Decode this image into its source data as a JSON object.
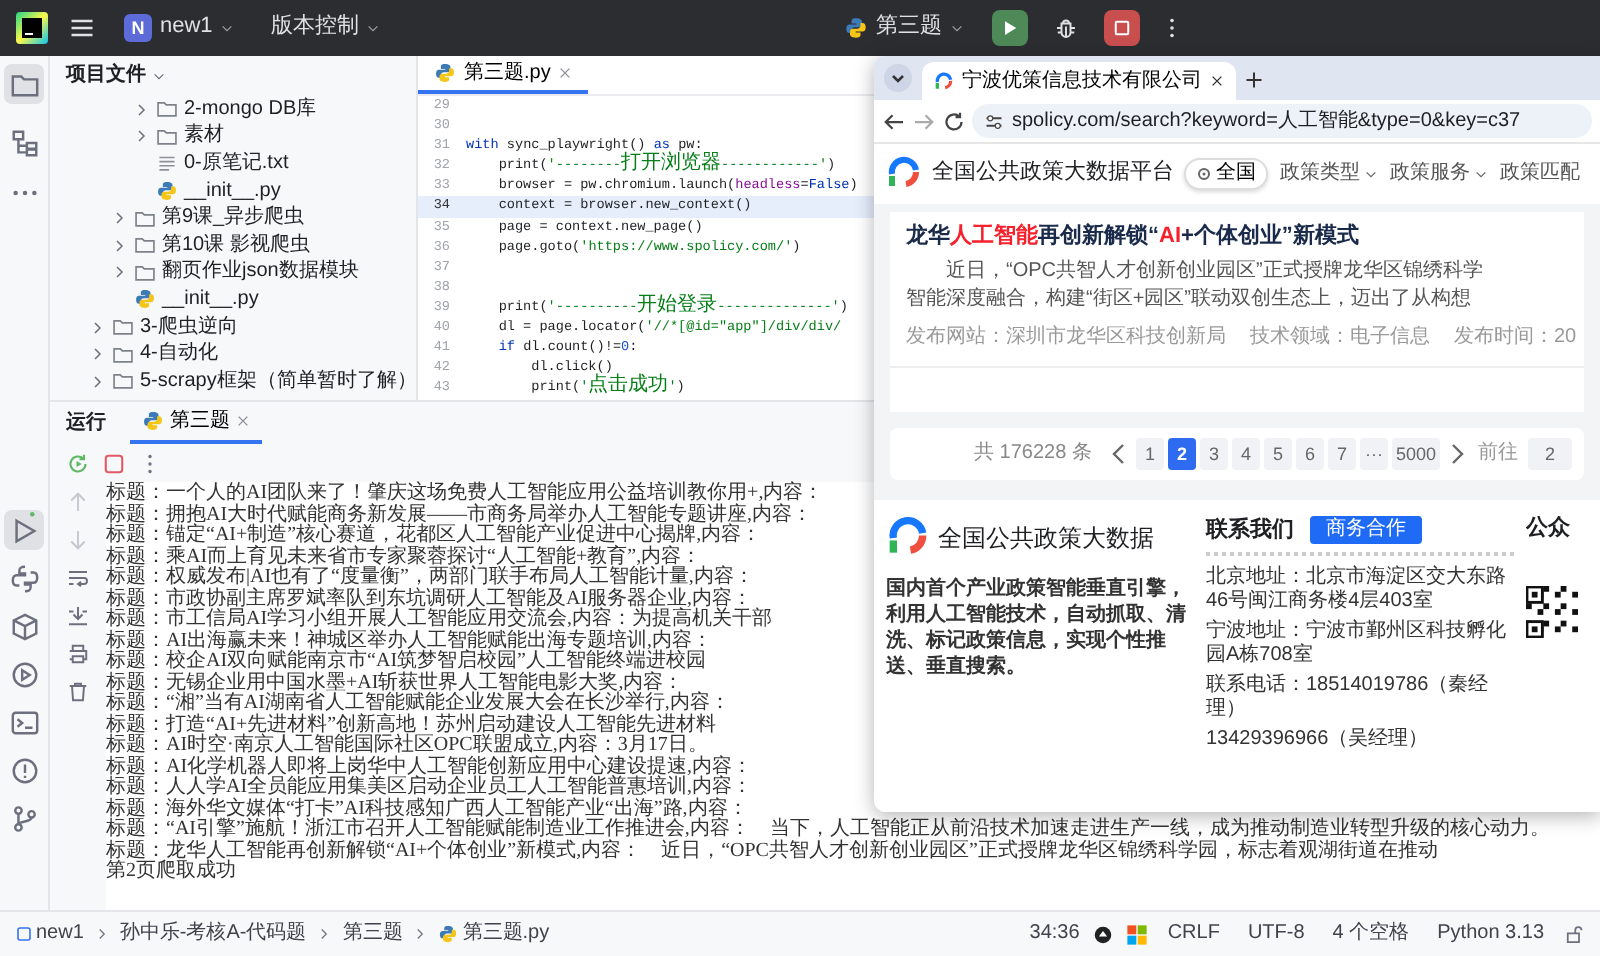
{
  "topbar": {
    "project_badge": "N",
    "project": "new1",
    "vcs": "版本控制",
    "run_config": "第三题"
  },
  "tool_strip_top": [
    {
      "kind": "project",
      "selected": true
    },
    {
      "kind": "structure",
      "selected": false
    },
    {
      "kind": "more",
      "selected": false
    }
  ],
  "tool_strip_bottom": [
    {
      "kind": "run",
      "selected": true,
      "running": true
    },
    {
      "kind": "python",
      "selected": false,
      "running": false
    },
    {
      "kind": "packages",
      "selected": false,
      "running": false
    },
    {
      "kind": "services",
      "selected": false,
      "running": false
    },
    {
      "kind": "terminal",
      "selected": false,
      "running": false
    },
    {
      "kind": "problems",
      "selected": false,
      "running": false
    },
    {
      "kind": "git",
      "selected": false,
      "running": false
    }
  ],
  "project_panel": {
    "title": "项目文件",
    "tree": [
      {
        "children": [
          {
            "children": [
              {
                "label": "2-mongo DB库",
                "kind": "folder",
                "expanded": false
              },
              {
                "label": "素材",
                "kind": "folder",
                "expanded": false
              },
              {
                "label": "0-原笔记.txt",
                "kind": "text"
              },
              {
                "label": "__init__.py",
                "kind": "python"
              }
            ]
          },
          {
            "label": "第9课_异步爬虫",
            "kind": "folder",
            "expanded": false
          },
          {
            "label": "第10课 影视爬虫",
            "kind": "folder",
            "expanded": false
          },
          {
            "label": "翻页作业json数据模块",
            "kind": "folder",
            "expanded": false
          },
          {
            "label": "__init__.py",
            "kind": "python"
          }
        ]
      },
      {
        "label": "3-爬虫逆向",
        "kind": "folder",
        "expanded": false
      },
      {
        "label": "4-自动化",
        "kind": "folder",
        "expanded": false
      },
      {
        "label": "5-scrapy框架（简单暂时了解）",
        "kind": "folder",
        "expanded": false
      }
    ]
  },
  "editor": {
    "tab": {
      "label": "第三题.py",
      "selected": true
    },
    "lines": [
      {
        "number": "29",
        "current": false
      },
      {
        "number": "30",
        "current": false
      },
      {
        "number": "31",
        "code": "with sync_playwright() as pw:",
        "current": false
      },
      {
        "number": "32",
        "code": "    print('--------打开浏览器------------')",
        "current": false
      },
      {
        "number": "33",
        "code": "    browser = pw.chromium.launch(headless=False)",
        "current": false
      },
      {
        "number": "34",
        "code": "    context = browser.new_context()",
        "current": true
      },
      {
        "number": "35",
        "code": "    page = context.new_page()",
        "current": false
      },
      {
        "number": "36",
        "code": "    page.goto('https://www.spolicy.com/')",
        "current": false
      },
      {
        "number": "37",
        "current": false
      },
      {
        "number": "38",
        "current": false
      },
      {
        "number": "39",
        "code": "    print('----------开始登录--------------')",
        "current": false
      },
      {
        "number": "40",
        "code": "    dl = page.locator('//*[@id=\"app\"]/div/div/",
        "current": false
      },
      {
        "number": "41",
        "code": "    if dl.count()!=0:",
        "current": false
      },
      {
        "number": "42",
        "code": "        dl.click()",
        "current": false
      },
      {
        "number": "43",
        "code": "        print('点击成功')",
        "current": false
      }
    ]
  },
  "run_panel": {
    "title": "运行",
    "tab": {
      "label": "第三题",
      "selected": true
    },
    "actions": [
      {
        "kind": "rerun"
      },
      {
        "kind": "stop"
      },
      {
        "kind": "more"
      }
    ],
    "side_actions": [
      {
        "kind": "up",
        "disabled": true
      },
      {
        "kind": "down",
        "disabled": true
      },
      {
        "kind": "wrap",
        "disabled": false
      },
      {
        "kind": "scroll-end",
        "disabled": false
      },
      {
        "kind": "print",
        "disabled": false
      },
      {
        "kind": "trash",
        "disabled": false
      }
    ],
    "output": [
      "标题：一个人的AI团队来了！肇庆这场免费人工智能应用公益培训教你用+,内容：",
      "标题：拥抱AI大时代赋能商务新发展——市商务局举办人工智能专题讲座,内容：",
      "标题：锚定“AI+制造”核心赛道，花都区人工智能产业促进中心揭牌,内容：",
      "标题：乘AI而上育见未来省市专家聚蓉探讨“人工智能+教育”,内容：",
      "标题：权威发布|AI也有了“度量衡”，两部门联手布局人工智能计量,内容：",
      "标题：市政协副主席罗斌率队到东坑调研人工智能及AI服务器企业,内容：",
      "标题：市工信局AI学习小组开展人工智能应用交流会,内容：为提高机关干部",
      "标题：AI出海赢未来！神城区举办人工智能赋能出海专题培训,内容：",
      "标题：校企AI双向赋能南京市“AI筑梦智启校园”人工智能终端进校园",
      "标题：无锡企业用中国水墨+AI斩获世界人工智能电影大奖,内容：",
      "标题：“湘”当有AI湖南省人工智能赋能企业发展大会在长沙举行,内容：",
      "标题：打造“AI+先进材料”创新高地！苏州启动建设人工智能先进材料",
      "标题：AI时空·南京人工智能国际社区OPC联盟成立,内容：3月17日。",
      "标题：AI化学机器人即将上岗华中人工智能创新应用中心建设提速,内容：",
      "标题：人人学AI全员能应用集美区启动企业员工人工智能普惠培训,内容：",
      "标题：海外华文媒体“打卡”AI科技感知广西人工智能产业“出海”路,内容：",
      "标题：“AI引擎”施航！浙江市召开人工智能赋能制造业工作推进会,内容：　当下，人工智能正从前沿技术加速走进生产一线，成为推动制造业转型升级的核心动力。",
      "标题：龙华人工智能再创新解锁“AI+个体创业”新模式,内容：　近日，“OPC共智人才创新创业园区”正式授牌龙华区锦绣科学园，标志着观湖街道在推动",
      "第2页爬取成功"
    ]
  },
  "browser": {
    "tab": {
      "title": "宁波优策信息技术有限公司",
      "selected": true
    },
    "url": "spolicy.com/search?keyword=人工智能&type=0&key=c37",
    "site": {
      "title": "全国公共政策大数据平台",
      "region": "全国",
      "nav": [
        {
          "label": "政策类型",
          "dropdown": true
        },
        {
          "label": "政策服务",
          "dropdown": true
        },
        {
          "label": "政策匹配",
          "dropdown": false
        }
      ]
    },
    "result": {
      "title_parts": [
        {
          "text": "龙华",
          "highlight": false
        },
        {
          "text": "人工智能",
          "highlight": true
        },
        {
          "text": "再创新解锁“",
          "highlight": false
        },
        {
          "text": "AI",
          "highlight": true
        },
        {
          "text": "+个体创业”新模式",
          "highlight": false
        }
      ],
      "lines": [
        "　　近日，“OPC共智人才创新创业园区”正式授牌龙华区锦绣科学",
        "智能深度融合，构建“街区+园区”联动双创生态上，迈出了从构想"
      ],
      "meta": [
        "发布网站：深圳市龙华区科技创新局",
        "技术领域：电子信息",
        "发布时间：20"
      ]
    },
    "pagination": {
      "total": "共 176228 条",
      "pages": [
        {
          "label": "1",
          "selected": false
        },
        {
          "label": "2",
          "selected": true
        },
        {
          "label": "3",
          "selected": false
        },
        {
          "label": "4",
          "selected": false
        },
        {
          "label": "5",
          "selected": false
        },
        {
          "label": "6",
          "selected": false
        },
        {
          "label": "7",
          "selected": false
        },
        {
          "label": "···",
          "selected": false
        },
        {
          "label": "5000",
          "selected": false
        }
      ],
      "goto_label": "前往",
      "goto_value": "2"
    },
    "footer": {
      "brand": "全国公共政策大数据",
      "description": "国内首个产业政策智能垂直引擎，利用人工智能技术，自动抓取、清洗、标记政策信息，实现个性推送、垂直搜索。",
      "contact_title": "联系我们",
      "contact_button": "商务合作",
      "contacts": [
        "北京地址：北京市海淀区交大东路46号闽江商务楼4层403室",
        "宁波地址：宁波市鄞州区科技孵化园A栋708室",
        "联系电话：18514019786（秦经理）",
        "13429396966（吴经理）"
      ],
      "wechat_title": "公众"
    }
  },
  "status_bar": {
    "breadcrumbs": [
      "new1",
      "孙中乐-考核A-代码题",
      "第三题",
      "第三题.py"
    ],
    "position": "34:36",
    "line_ending": "CRLF",
    "encoding": "UTF-8",
    "indent": "4 个空格",
    "interpreter": "Python 3.13"
  }
}
